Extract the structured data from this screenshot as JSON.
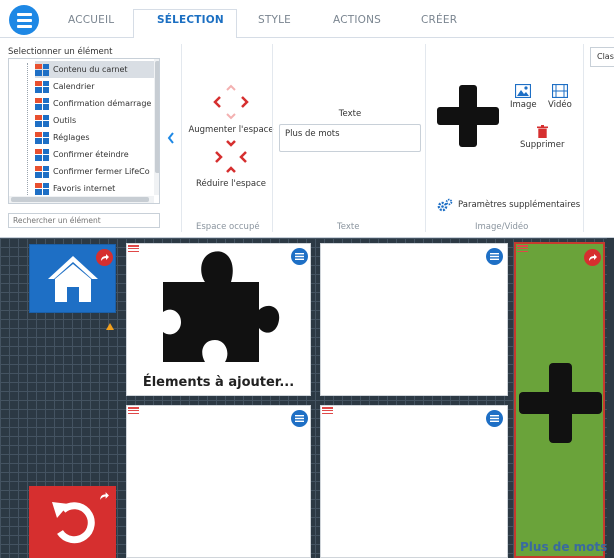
{
  "tabs": [
    {
      "label": "ACCUEIL",
      "active": false
    },
    {
      "label": "SÉLECTION",
      "active": true
    },
    {
      "label": "STYLE",
      "active": false
    },
    {
      "label": "ACTIONS",
      "active": false
    },
    {
      "label": "CRÉER",
      "active": false
    }
  ],
  "selection": {
    "label": "Selectionner un élément",
    "items": [
      {
        "label": "Contenu du carnet",
        "selected": true
      },
      {
        "label": "Calendrier",
        "selected": false
      },
      {
        "label": "Confirmation démarrage",
        "selected": false
      },
      {
        "label": "Outils",
        "selected": false
      },
      {
        "label": "Réglages",
        "selected": false
      },
      {
        "label": "Confirmer éteindre",
        "selected": false
      },
      {
        "label": "Confirmer fermer LifeCo",
        "selected": false
      },
      {
        "label": "Favoris internet",
        "selected": false
      }
    ],
    "search_placeholder": "Rechercher un élément"
  },
  "space_group": {
    "increase_label": "Augmenter l'espace",
    "decrease_label": "Réduire l'espace",
    "group_label": "Espace occupé"
  },
  "text_group": {
    "title": "Texte",
    "value": "Plus de mots",
    "group_label": "Texte"
  },
  "image_group": {
    "image_label": "Image",
    "video_label": "Vidéo",
    "delete_label": "Supprimer",
    "params_label": "Paramètres supplémentaires",
    "group_label": "Image/Vidéo"
  },
  "clas_cut_label": "Clas",
  "grid": {
    "puzzle_caption": "Élements à ajouter...",
    "green_caption": "Plus de mots"
  },
  "colors": {
    "accent": "#1e6fc5",
    "danger": "#d62f2f",
    "grid_bg": "#2c3944",
    "green_tile": "#6aa33a",
    "warning": "#f2a01d"
  }
}
